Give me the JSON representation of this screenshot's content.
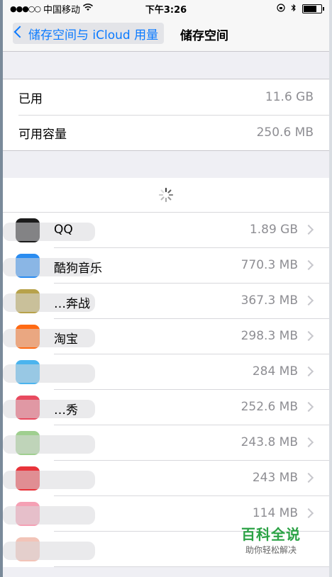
{
  "status_bar": {
    "signal": "●●●○○",
    "carrier": "中国移动",
    "wifi_icon": "wifi-icon",
    "time": "下午3:26",
    "lock_icon": "orientation-lock-icon",
    "bluetooth_icon": "bluetooth-icon",
    "battery_level": 0.7
  },
  "nav": {
    "back_label": "储存空间与 iCloud 用量",
    "title": "储存空间"
  },
  "storage": {
    "used_label": "已用",
    "used_value": "11.6 GB",
    "available_label": "可用容量",
    "available_value": "250.6 MB"
  },
  "apps": [
    {
      "name": "QQ",
      "size": "1.89 GB",
      "color": "#1b1b1b"
    },
    {
      "name": "酷狗音乐",
      "size": "770.3 MB",
      "color": "#2a8cf0"
    },
    {
      "name": "…奔战",
      "size": "367.3 MB",
      "color": "#b7a24a"
    },
    {
      "name": "淘宝",
      "size": "298.3 MB",
      "color": "#ff6a13"
    },
    {
      "name": "",
      "size": "284 MB",
      "color": "#4bb4ee"
    },
    {
      "name": "…秀",
      "size": "252.6 MB",
      "color": "#e84a5f"
    },
    {
      "name": "",
      "size": "243.8 MB",
      "color": "#9fcf8f"
    },
    {
      "name": "",
      "size": "243 MB",
      "color": "#e8333a"
    },
    {
      "name": "",
      "size": "114 MB",
      "color": "#f5a0b4"
    },
    {
      "name": "",
      "size": "",
      "color": "#f2c4b8"
    }
  ],
  "watermark": {
    "title": "百科全说",
    "subtitle": "助你轻松解决"
  }
}
